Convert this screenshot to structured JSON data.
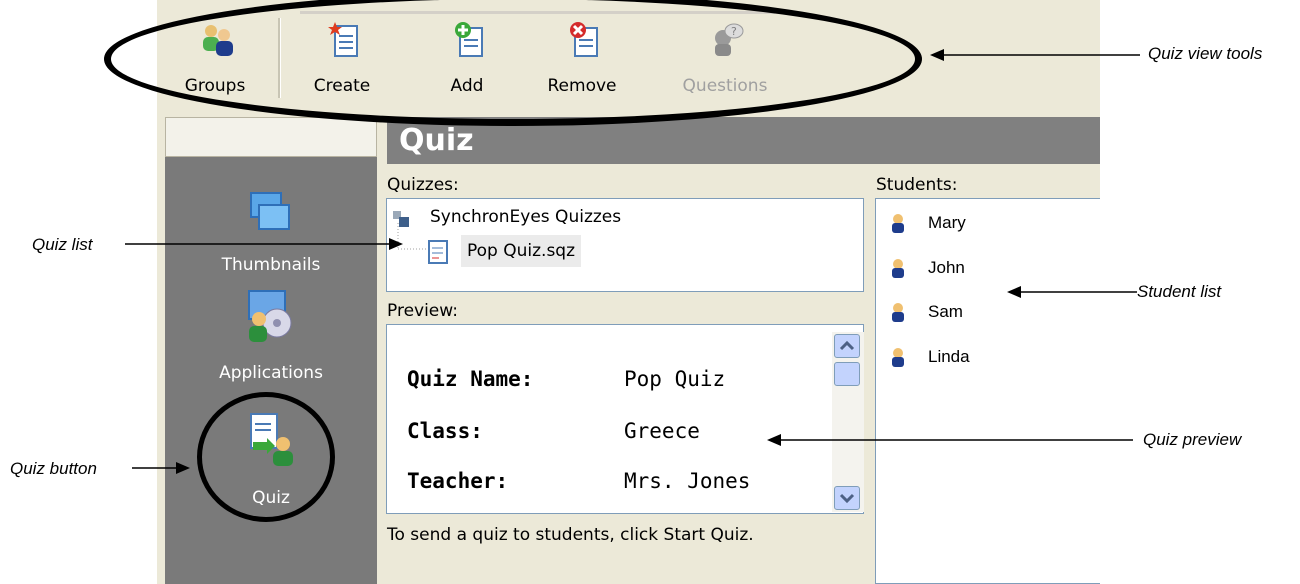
{
  "toolbar": {
    "buttons": [
      {
        "label": "Groups",
        "icon": "groups-icon"
      },
      {
        "label": "Create",
        "icon": "create-quiz-icon"
      },
      {
        "label": "Add",
        "icon": "add-quiz-icon"
      },
      {
        "label": "Remove",
        "icon": "remove-quiz-icon"
      },
      {
        "label": "Questions",
        "icon": "questions-icon",
        "disabled": true
      }
    ]
  },
  "sidebar": {
    "items": [
      {
        "label": "Thumbnails",
        "icon": "thumbnails-icon"
      },
      {
        "label": "Applications",
        "icon": "applications-icon"
      },
      {
        "label": "Quiz",
        "icon": "quiz-icon"
      }
    ]
  },
  "main": {
    "header": "Quiz",
    "quizzes_label": "Quizzes:",
    "tree": {
      "root": "SynchronEyes Quizzes",
      "child": "Pop Quiz.sqz"
    },
    "preview_label": "Preview:",
    "preview": {
      "rows": [
        {
          "key": "Quiz Name:",
          "value": "Pop Quiz"
        },
        {
          "key": "Class:",
          "value": "Greece"
        },
        {
          "key": "Teacher:",
          "value": "Mrs. Jones"
        }
      ]
    },
    "hint": "To send a quiz to students, click Start Quiz.",
    "students_label": "Students:",
    "students": [
      "Mary",
      "John",
      "Sam",
      "Linda"
    ]
  },
  "callouts": {
    "quiz_view_tools": "Quiz view tools",
    "quiz_list": "Quiz list",
    "student_list": "Student list",
    "quiz_preview": "Quiz preview",
    "quiz_button": "Quiz button"
  },
  "colors": {
    "toolbar_bg": "#ece9d8",
    "sidebar_bg": "#7a7a7a",
    "header_bg": "#808080",
    "panel_border": "#7f9db9"
  }
}
